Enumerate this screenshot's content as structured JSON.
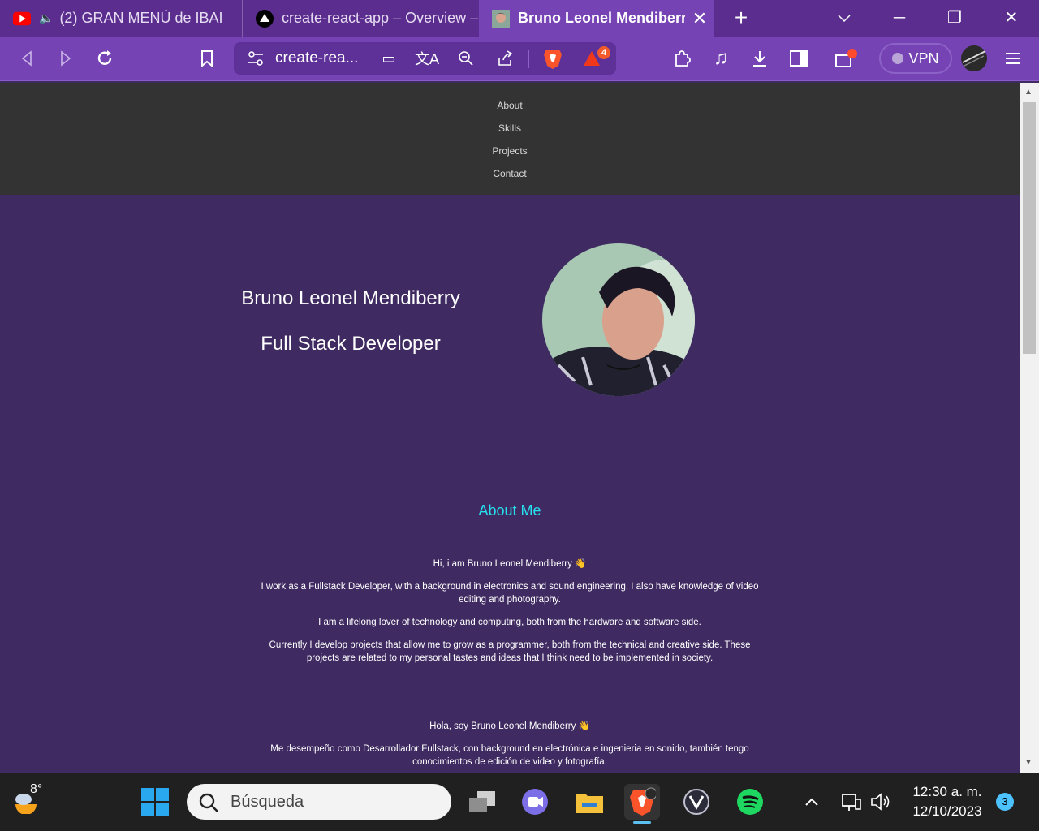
{
  "browser": {
    "tabs": [
      {
        "title": "(2) GRAN MENÚ de IBAI",
        "favicon": "youtube-icon"
      },
      {
        "title": "create-react-app – Overview –",
        "favicon": "vercel-icon"
      },
      {
        "title": "Bruno Leonel Mendiberry",
        "favicon": "profile-photo-icon",
        "active": true
      }
    ],
    "address": "create-rea...",
    "vpn_label": "VPN",
    "rewards_badge": "4"
  },
  "page": {
    "nav": [
      "About",
      "Skills",
      "Projects",
      "Contact"
    ],
    "hero": {
      "name": "Bruno Leonel Mendiberry",
      "role": "Full Stack Developer"
    },
    "about": {
      "title": "About Me",
      "english": [
        "Hi, i am Bruno Leonel Mendiberry 👋",
        "I work as a Fullstack Developer, with a background in electronics and sound engineering, I also have knowledge of video editing and photography.",
        "I am a lifelong lover of technology and computing, both from the hardware and software side.",
        "Currently I develop projects that allow me to grow as a programmer, both from the technical and creative side. These projects are related to my personal tastes and ideas that I think need to be implemented in society."
      ],
      "spanish": [
        "Hola, soy Bruno Leonel Mendiberry 👋",
        "Me desempeño como Desarrollador Fullstack, con background en electrónica e ingenieria en sonido, también tengo conocimientos de edición de video y fotografía."
      ]
    },
    "colors": {
      "background": "#3f2b61",
      "nav": "#333333",
      "accent": "#27e0f0"
    }
  },
  "taskbar": {
    "weather_temp": "8°",
    "search_placeholder": "Búsqueda",
    "time": "12:30 a. m.",
    "date": "12/10/2023",
    "notifications": "3"
  }
}
